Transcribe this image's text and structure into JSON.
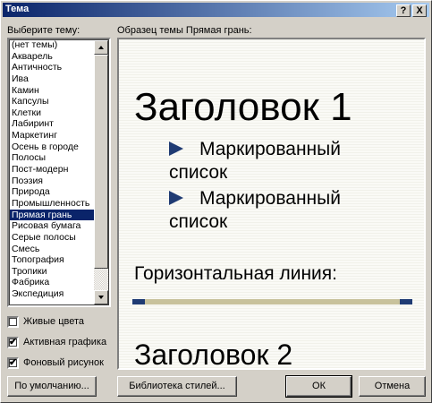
{
  "window": {
    "title": "Тема",
    "help_label": "?",
    "close_label": "X"
  },
  "theme_list": {
    "label": "Выберите тему:",
    "selected": "Прямая грань",
    "items": [
      "(нет темы)",
      "Акварель",
      "Античность",
      "Ива",
      "Камин",
      "Капсулы",
      "Клетки",
      "Лабиринт",
      "Маркетинг",
      "Осень в городе",
      "Полосы",
      "Пост-модерн",
      "Поэзия",
      "Природа",
      "Промышленность",
      "Прямая грань",
      "Рисовая бумага",
      "Серые полосы",
      "Смесь",
      "Топография",
      "Тропики",
      "Фабрика",
      "Экспедиция"
    ]
  },
  "preview": {
    "label": "Образец темы Прямая грань:",
    "heading1": "Заголовок 1",
    "bullet1_line1": "Маркированный",
    "bullet1_line2": "список",
    "bullet2_line1": "Маркированный",
    "bullet2_line2": "список",
    "hline_label": "Горизонтальная линия:",
    "heading2": "Заголовок 2",
    "accent_color": "#1f3b73",
    "line_color": "#c8c29c"
  },
  "options": {
    "vivid_colors": {
      "label": "Живые цвета",
      "checked": false
    },
    "active_graphics": {
      "label": "Активная графика",
      "checked": true
    },
    "background_image": {
      "label": "Фоновый рисунок",
      "checked": true
    }
  },
  "buttons": {
    "default": "По умолчанию...",
    "style_gallery": "Библиотека стилей...",
    "ok": "ОК",
    "cancel": "Отмена"
  }
}
